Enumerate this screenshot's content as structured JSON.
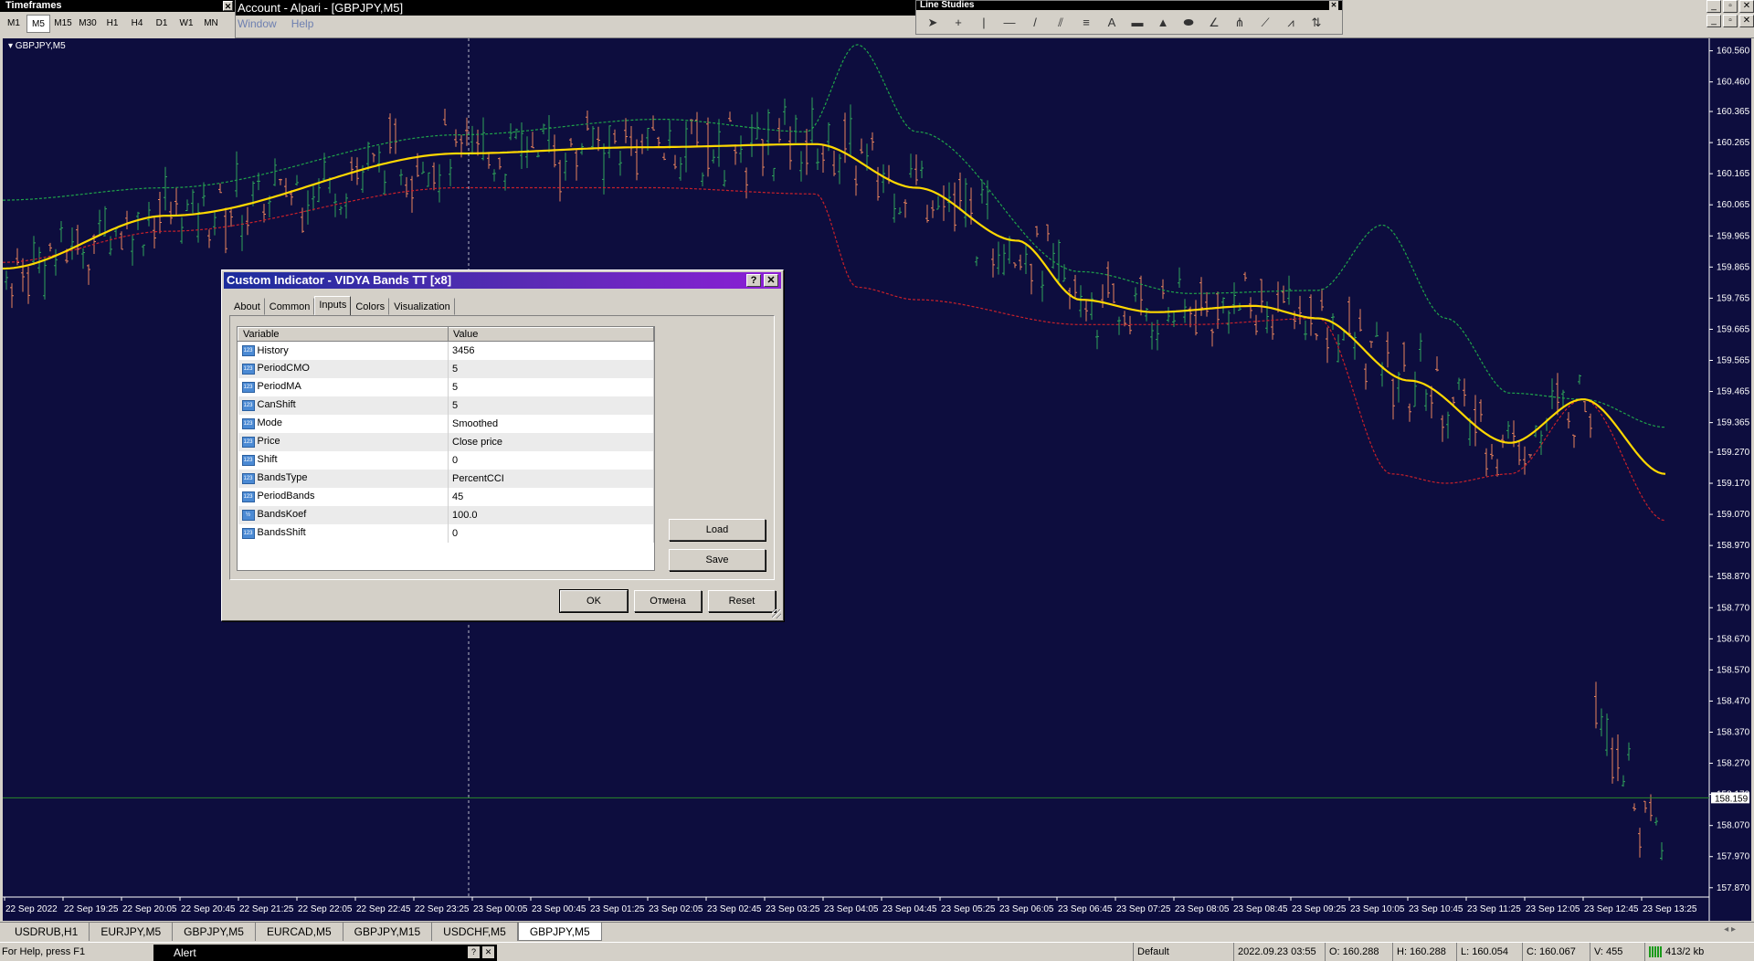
{
  "timeframes_panel": {
    "title": "Timeframes",
    "close": "✕",
    "buttons": [
      "M1",
      "M5",
      "M15",
      "M30",
      "H1",
      "H4",
      "D1",
      "W1",
      "MN"
    ],
    "active": "M5"
  },
  "window": {
    "title": "Account - Alpari - [GBPJPY,M5]",
    "menu": [
      "Window",
      "Help"
    ],
    "controls_top": [
      "_",
      "▫",
      "✕"
    ],
    "controls_child": [
      "_",
      "▫",
      "✕"
    ]
  },
  "line_studies": {
    "title": "Line Studies",
    "close": "✕",
    "tools": [
      {
        "name": "cursor-icon",
        "glyph": "➤"
      },
      {
        "name": "crosshair-icon",
        "glyph": "+"
      },
      {
        "name": "vertical-line-icon",
        "glyph": "|"
      },
      {
        "name": "horizontal-line-icon",
        "glyph": "—"
      },
      {
        "name": "trendline-icon",
        "glyph": "/"
      },
      {
        "name": "channel-icon",
        "glyph": "⫽"
      },
      {
        "name": "fibonacci-icon",
        "glyph": "≡"
      },
      {
        "name": "text-icon",
        "glyph": "A"
      },
      {
        "name": "rectangle-icon",
        "glyph": "▬"
      },
      {
        "name": "triangle-icon",
        "glyph": "▲"
      },
      {
        "name": "ellipse-icon",
        "glyph": "⬬"
      },
      {
        "name": "gann-icon",
        "glyph": "∠"
      },
      {
        "name": "pitchfork-icon",
        "glyph": "⋔"
      },
      {
        "name": "cycle-lines-icon",
        "glyph": "⟋"
      },
      {
        "name": "fibo-fan-icon",
        "glyph": "⩘"
      },
      {
        "name": "arrows-icon",
        "glyph": "⇅"
      }
    ]
  },
  "chart": {
    "symbol_label": "▾ GBPJPY,M5",
    "price_labels": [
      "160.560",
      "160.460",
      "160.365",
      "160.265",
      "160.165",
      "160.065",
      "159.965",
      "159.865",
      "159.765",
      "159.665",
      "159.565",
      "159.465",
      "159.365",
      "159.270",
      "159.170",
      "159.070",
      "158.970",
      "158.870",
      "158.770",
      "158.670",
      "158.570",
      "158.470",
      "158.370",
      "158.270",
      "158.170",
      "158.070",
      "157.970",
      "157.870"
    ],
    "current_price": "158.159",
    "time_labels": [
      "22 Sep 2022",
      "22 Sep 19:25",
      "22 Sep 20:05",
      "22 Sep 20:45",
      "22 Sep 21:25",
      "22 Sep 22:05",
      "22 Sep 22:45",
      "22 Sep 23:25",
      "23 Sep 00:05",
      "23 Sep 00:45",
      "23 Sep 01:25",
      "23 Sep 02:05",
      "23 Sep 02:45",
      "23 Sep 03:25",
      "23 Sep 04:05",
      "23 Sep 04:45",
      "23 Sep 05:25",
      "23 Sep 06:05",
      "23 Sep 06:45",
      "23 Sep 07:25",
      "23 Sep 08:05",
      "23 Sep 08:45",
      "23 Sep 09:25",
      "23 Sep 10:05",
      "23 Sep 10:45",
      "23 Sep 11:25",
      "23 Sep 12:05",
      "23 Sep 12:45",
      "23 Sep 13:25"
    ],
    "colors": {
      "background": "#0d0d3e",
      "bull": "#2fa35a",
      "bear": "#e8825c",
      "midline": "#ffd800",
      "upper_band": "#1fa34a",
      "lower_band": "#c8202a",
      "price_line": "#2a8a2a"
    }
  },
  "dialog": {
    "title": "Custom Indicator - VIDYA Bands TT [x8]",
    "help_btn": "?",
    "close_btn": "✕",
    "tabs": [
      "About",
      "Common",
      "Inputs",
      "Colors",
      "Visualization"
    ],
    "active_tab": "Inputs",
    "columns": [
      "Variable",
      "Value"
    ],
    "rows": [
      {
        "variable": "History",
        "value": "3456",
        "type": "123"
      },
      {
        "variable": "PeriodCMO",
        "value": "5",
        "type": "123"
      },
      {
        "variable": "PeriodMA",
        "value": "5",
        "type": "123"
      },
      {
        "variable": "CanShift",
        "value": "5",
        "type": "123"
      },
      {
        "variable": "Mode",
        "value": "Smoothed",
        "type": "123"
      },
      {
        "variable": "Price",
        "value": "Close price",
        "type": "123"
      },
      {
        "variable": "Shift",
        "value": "0",
        "type": "123"
      },
      {
        "variable": "BandsType",
        "value": "PercentCCI",
        "type": "123"
      },
      {
        "variable": "PeriodBands",
        "value": "45",
        "type": "123"
      },
      {
        "variable": "BandsKoef",
        "value": "100.0",
        "type": "½"
      },
      {
        "variable": "BandsShift",
        "value": "0",
        "type": "123"
      }
    ],
    "load": "Load",
    "save": "Save",
    "ok": "OK",
    "cancel": "Отмена",
    "reset": "Reset"
  },
  "tabs": {
    "items": [
      "USDRUB,H1",
      "EURJPY,M5",
      "GBPJPY,M5",
      "EURCAD,M5",
      "GBPJPY,M15",
      "USDCHF,M5",
      "GBPJPY,M5"
    ],
    "active_index": 6,
    "arrows": "◂ ▸"
  },
  "status": {
    "help": "For Help, press F1",
    "alert_title": "Alert",
    "profile": "Default",
    "datetime": "2022.09.23 03:55",
    "open": "O: 160.288",
    "high": "H: 160.288",
    "low": "L: 160.054",
    "close": "C: 160.067",
    "volume": "V: 455",
    "traffic": "413/2 kb"
  }
}
